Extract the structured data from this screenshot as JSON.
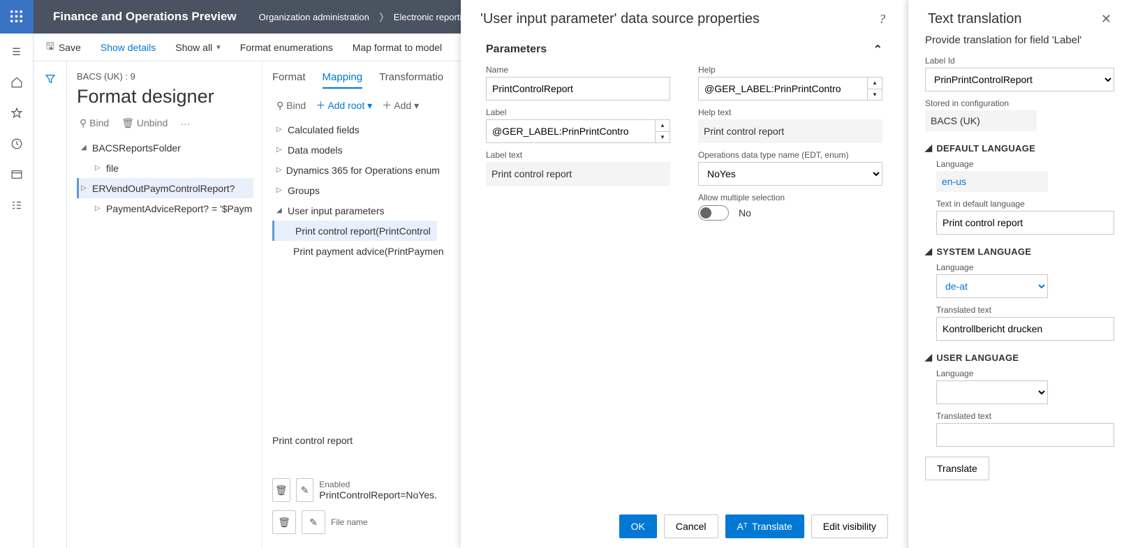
{
  "topbar": {
    "product": "Finance and Operations Preview",
    "crumb1": "Organization administration",
    "crumb2": "Electronic reporting"
  },
  "cmd": {
    "save": "Save",
    "show_details": "Show details",
    "show_all": "Show all",
    "format_enum": "Format enumerations",
    "map_format": "Map format to model"
  },
  "main": {
    "crumb": "BACS (UK) : 9",
    "title": "Format designer",
    "bind": "Bind",
    "unbind": "Unbind"
  },
  "tree": {
    "root": "BACSReportsFolder",
    "file": "file",
    "er": "ERVendOutPaymControlReport?",
    "pa": "PaymentAdviceReport? = '$Paym"
  },
  "tabs": {
    "format": "Format",
    "mapping": "Mapping",
    "transformations": "Transformations"
  },
  "midtool": {
    "bind": "Bind",
    "addroot": "Add root",
    "add": "Add"
  },
  "dtree": {
    "calc": "Calculated fields",
    "data_models": "Data models",
    "d365enum": "Dynamics 365 for Operations enum",
    "groups": "Groups",
    "uip": "User input parameters",
    "p1": "Print control report(PrintControl",
    "p2": "Print payment advice(PrintPaymen"
  },
  "mf": {
    "label": "Print control report",
    "enabled_l": "Enabled",
    "enabled_v": "PrintControlReport=NoYes.",
    "file_l": "File name"
  },
  "panel": {
    "title": "'User input parameter' data source properties",
    "section": "Parameters",
    "name_l": "Name",
    "name_v": "PrintControlReport",
    "label_l": "Label",
    "label_v": "@GER_LABEL:PrinPrintContro",
    "labeltext_l": "Label text",
    "labeltext_v": "Print control report",
    "help_l": "Help",
    "help_v": "@GER_LABEL:PrinPrintContro",
    "helptext_l": "Help text",
    "helptext_v": "Print control report",
    "ops_l": "Operations data type name (EDT, enum)",
    "ops_v": "NoYes",
    "multi_l": "Allow multiple selection",
    "multi_v": "No",
    "ok": "OK",
    "cancel": "Cancel",
    "translate": "Translate",
    "editvis": "Edit visibility"
  },
  "p2": {
    "title": "Text translation",
    "subtitle": "Provide translation for field 'Label'",
    "labelid_l": "Label Id",
    "labelid_v": "PrinPrintControlReport",
    "stored_l": "Stored in configuration",
    "stored_v": "BACS (UK)",
    "defh": "DEFAULT LANGUAGE",
    "lang_l": "Language",
    "deflang": "en-us",
    "txtdef_l": "Text in default language",
    "txtdef_v": "Print control report",
    "sysh": "SYSTEM LANGUAGE",
    "syslang": "de-at",
    "trtxt_l": "Translated text",
    "trtxt_v": "Kontrollbericht drucken",
    "userh": "USER LANGUAGE",
    "translate": "Translate"
  }
}
